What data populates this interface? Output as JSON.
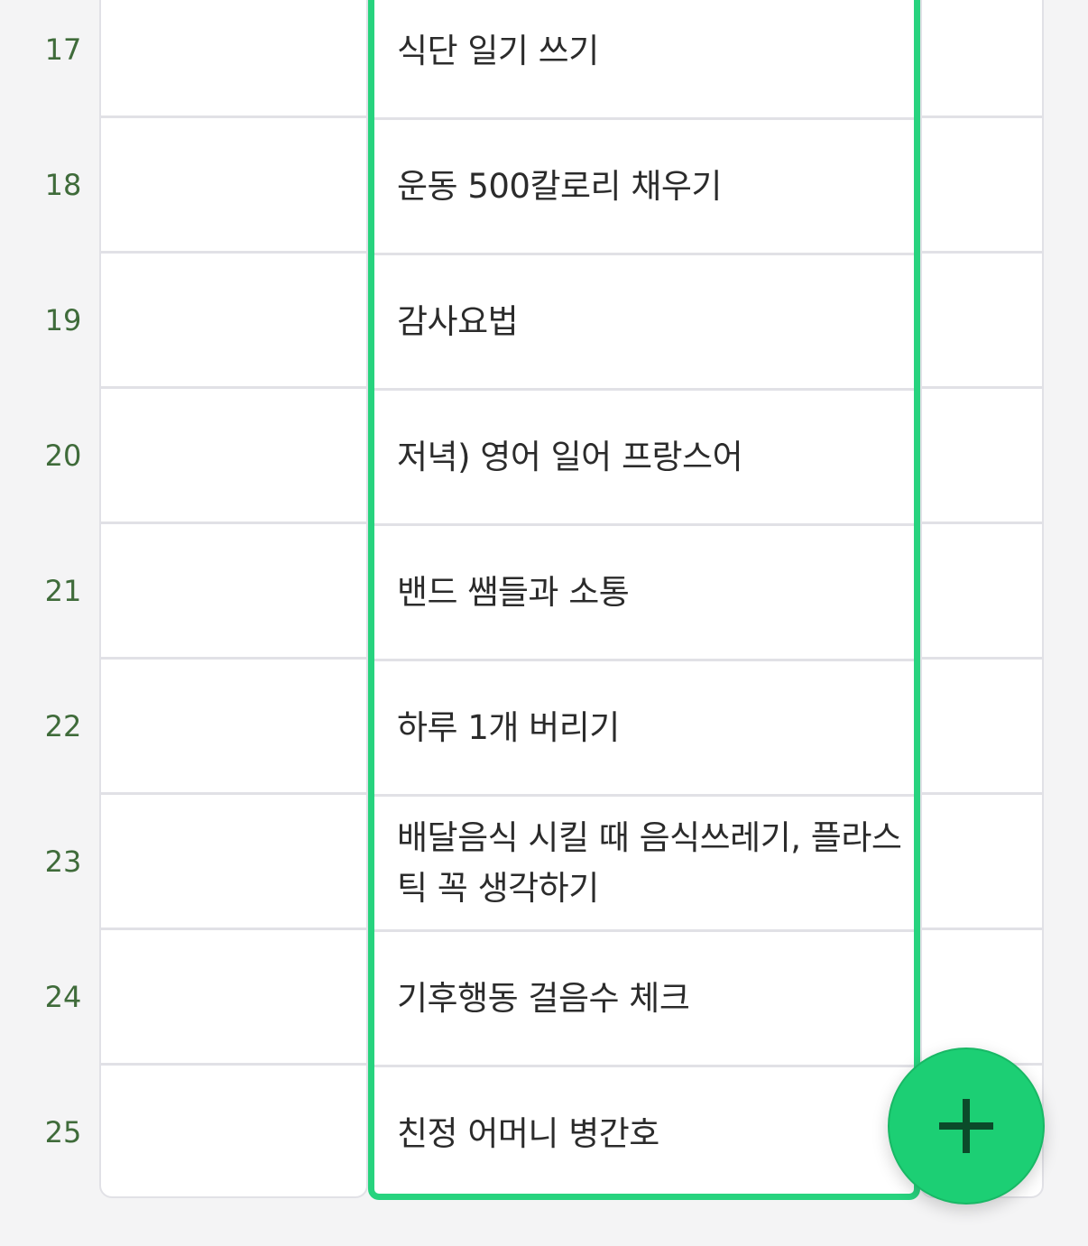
{
  "rows": [
    {
      "num": "17",
      "task": "식단 일기 쓰기"
    },
    {
      "num": "18",
      "task": "운동 500칼로리 채우기"
    },
    {
      "num": "19",
      "task": "감사요법"
    },
    {
      "num": "20",
      "task": "저녁) 영어 일어 프랑스어"
    },
    {
      "num": "21",
      "task": "밴드 쌤들과 소통"
    },
    {
      "num": "22",
      "task": "하루 1개 버리기"
    },
    {
      "num": "23",
      "task": "배달음식 시킬 때 음식쓰레기, 플라스틱 꼭 생각하기"
    },
    {
      "num": "24",
      "task": "기후행동 걸음수 체크"
    },
    {
      "num": "25",
      "task": "친정 어머니 병간호"
    }
  ],
  "fab": {
    "icon": "plus-icon"
  },
  "colors": {
    "selected_column_border": "#27d37e",
    "fab_background": "#1ccf74",
    "row_number": "#3f6b3a",
    "grid_line": "#e1e1e6"
  }
}
